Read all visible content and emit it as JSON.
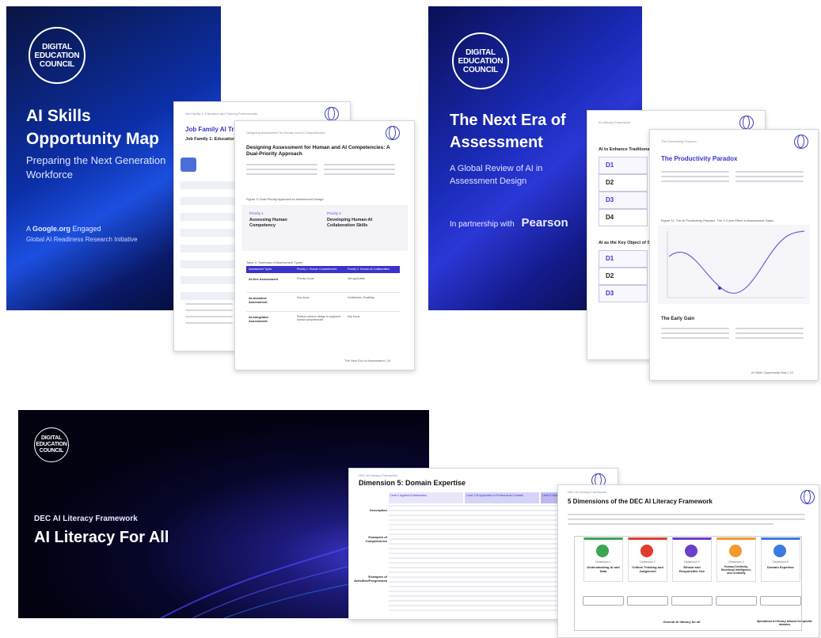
{
  "cover1": {
    "logo": [
      "DIGITAL",
      "EDUCATION",
      "COUNCIL"
    ],
    "title_line1": "AI Skills",
    "title_line2": "Opportunity Map",
    "subtitle_line1": "Preparing the Next Generation",
    "subtitle_line2": "Workforce",
    "engaged_prefix": "A ",
    "engaged_brand": "Google.org",
    "engaged_suffix": " Engaged",
    "initiative": "Global AI Readiness Research Initiative"
  },
  "doc1_back": {
    "header": "Job Family 4: Education and Training Professionals",
    "title": "Job Family AI Tra",
    "subtitle": "Job Family 1: Education"
  },
  "doc1_front": {
    "header": "Designing Assessment for Human and AI Competencies",
    "title": "Designing Assessment for Human and AI Competencies: A Dual-Priority Approach",
    "figure_caption": "Figure 3: Dual-Priority Approach to Assessment Design",
    "priority1_tag": "Priority 1",
    "priority1_title": "Assessing Human Competency",
    "priority2_tag": "Priority 2",
    "priority2_title": "Developing Human-AI Collaboration Skills",
    "table_caption": "Table 4: Summary of Assessment Types",
    "table_headers": [
      "Assessment Types",
      "Priority 1: Human Competencies",
      "Priority 2: Human-AI Collaboration"
    ],
    "table_rows": [
      [
        "AI-free Assessment",
        "Primary focus",
        "Not applicable"
      ],
      [
        "AI-Assistive Assessment",
        "Key focus",
        "Contributes, Enabling"
      ],
      [
        "AI-Integrated Assessment",
        "Reduce random design to augment human competencies",
        "Key focus"
      ]
    ],
    "footer": "The Next Era of Assessment | 19"
  },
  "cover2": {
    "logo": [
      "DIGITAL",
      "EDUCATION",
      "COUNCIL"
    ],
    "title_line1": "The Next Era of",
    "title_line2": "Assessment",
    "subtitle_line1": "A Global Review of AI in",
    "subtitle_line2": "Assessment Design",
    "partnership_label": "In partnership with",
    "partner_brand": "Pearson"
  },
  "doc2_back": {
    "header": "AI Literacy Framework",
    "section1": "AI to Enhance Traditional A",
    "items1": [
      "D1",
      "D2",
      "D3",
      "D4"
    ],
    "section2": "AI as the Key Object of Stu",
    "items2": [
      "D1",
      "D2",
      "D3"
    ]
  },
  "doc2_front": {
    "header": "The Productivity Paradox",
    "title": "The Productivity Paradox",
    "figure_caption": "Figure 11: The AI Productivity Paradox: The J-Curve Effect in Assessment Tasks",
    "section": "The Early Gain",
    "footer": "AI Skills Opportunity Map | 13"
  },
  "cover3": {
    "logo": [
      "DIGITAL",
      "EDUCATION",
      "COUNCIL"
    ],
    "kicker": "DEC AI Literacy Framework",
    "title": "AI Literacy For All"
  },
  "doc3_back": {
    "header": "DEC AI Literacy Framework",
    "title": "Dimension 5: Domain Expertise",
    "col_headers": [
      "Level 1 Applied AI Awareness",
      "Level 2 AI Application in Professional Contexts",
      "Level 3 Strategic AI L"
    ],
    "row_labels": [
      "Description",
      "Examples of Competencies",
      "Examples of Activities/Progression"
    ]
  },
  "doc3_front": {
    "header": "DEC AI Literacy Framework",
    "title": "5 Dimensions of the DEC AI Literacy Framework",
    "dimensions": [
      {
        "num": "Dimension 1",
        "name": "Understanding AI and Data",
        "color": "#3aa655"
      },
      {
        "num": "Dimension 2",
        "name": "Critical Thinking and Judgement",
        "color": "#e23b2c"
      },
      {
        "num": "Dimension 3",
        "name": "Ethical and Responsible Use",
        "color": "#6a3fc9"
      },
      {
        "num": "Dimension 4",
        "name": "Human-Centricity, Emotional Intelligence, and Creativity",
        "color": "#f39a2e"
      },
      {
        "num": "Dimension 5",
        "name": "Domain Expertise",
        "color": "#3b7ae0"
      }
    ],
    "bottom_left": "General AI literacy for all",
    "bottom_right": "Specialised AI literacy tailored for specific domains"
  }
}
